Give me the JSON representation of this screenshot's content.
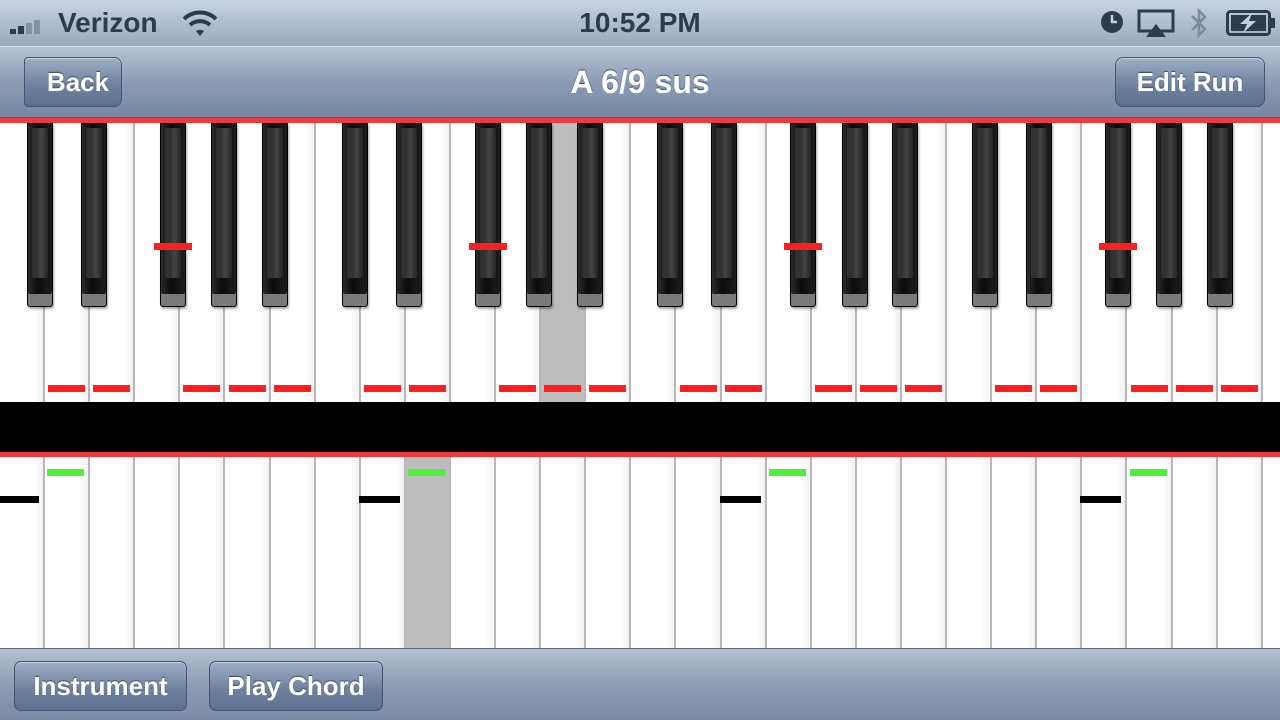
{
  "status_bar": {
    "carrier": "Verizon",
    "time": "10:52 PM",
    "icons": [
      "signal-bars-icon",
      "wifi-icon",
      "clock-icon",
      "airplay-icon",
      "bluetooth-icon",
      "battery-charging-icon"
    ]
  },
  "nav": {
    "title": "A 6/9 sus",
    "back_label": "Back",
    "edit_label": "Edit Run"
  },
  "keyboard": {
    "selected_chord": "A 6/9 sus",
    "highlight_color": "#bdbdbd",
    "upper_marker_color": "#ff1f1f",
    "lower_marker_colors": [
      "#51ee3d",
      "#000000"
    ]
  },
  "toolbar": {
    "instrument_label": "Instrument",
    "play_chord_label": "Play Chord"
  },
  "colors": {
    "nav_gradient_top": "#b7c3d4",
    "nav_gradient_bottom": "#7587a3",
    "separator_red": "#f03a3f"
  }
}
